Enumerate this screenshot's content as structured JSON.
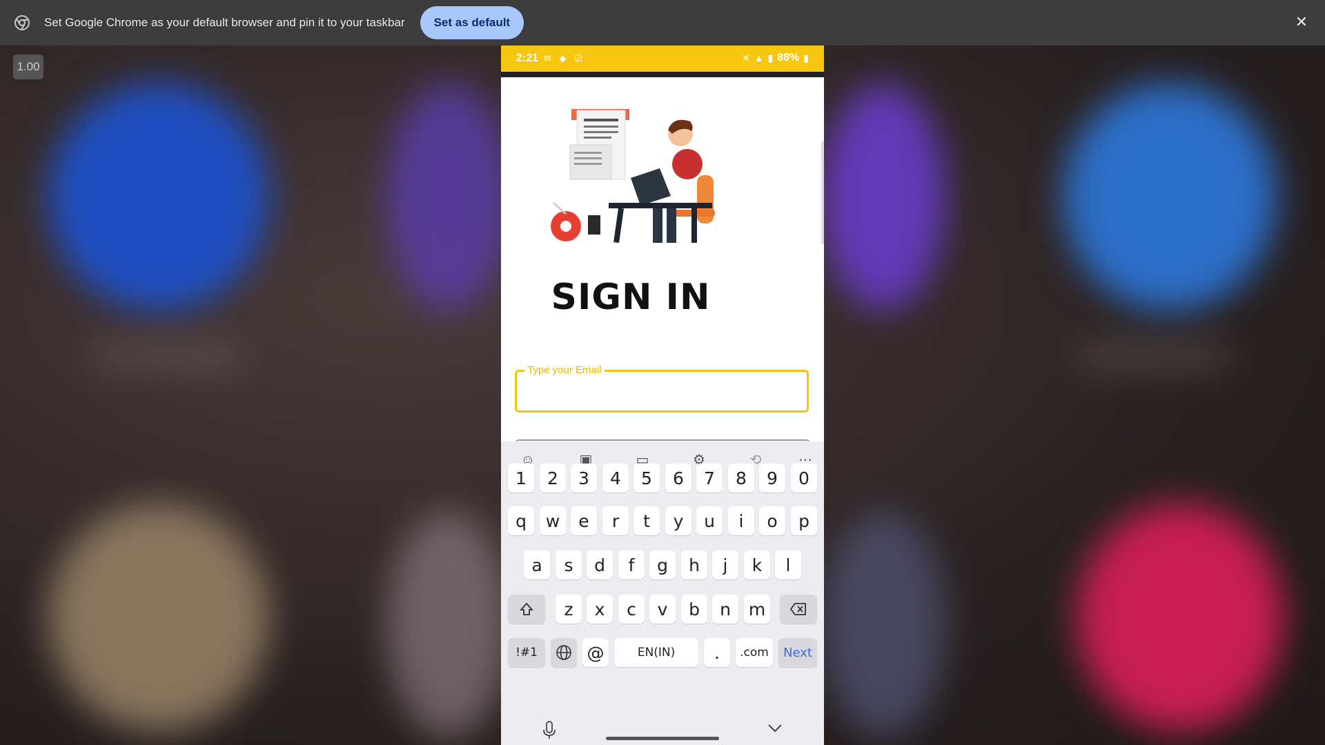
{
  "banner": {
    "message": "Set Google Chrome as your default browser and pin it to your taskbar",
    "button_label": "Set as default",
    "close_label": "✕"
  },
  "zoom_label": "1.00",
  "status": {
    "time": "2:21",
    "battery": "88%"
  },
  "screen": {
    "title": "SIGN IN",
    "email_label": "Type your Email",
    "email_value": ""
  },
  "keyboard": {
    "numbers": [
      "1",
      "2",
      "3",
      "4",
      "5",
      "6",
      "7",
      "8",
      "9",
      "0"
    ],
    "row1": [
      "q",
      "w",
      "e",
      "r",
      "t",
      "y",
      "u",
      "i",
      "o",
      "p"
    ],
    "row2": [
      "a",
      "s",
      "d",
      "f",
      "g",
      "h",
      "j",
      "k",
      "l"
    ],
    "row3": [
      "z",
      "x",
      "c",
      "v",
      "b",
      "n",
      "m"
    ],
    "symbols_label": "!#1",
    "at_label": "@",
    "space_label": "EN(IN)",
    "period_label": ".",
    "dotcom_label": ".com",
    "next_label": "Next"
  },
  "colors": {
    "accent_yellow": "#f7c60f",
    "chrome_button": "#a8c7fa",
    "next_blue": "#3b6fd8"
  }
}
